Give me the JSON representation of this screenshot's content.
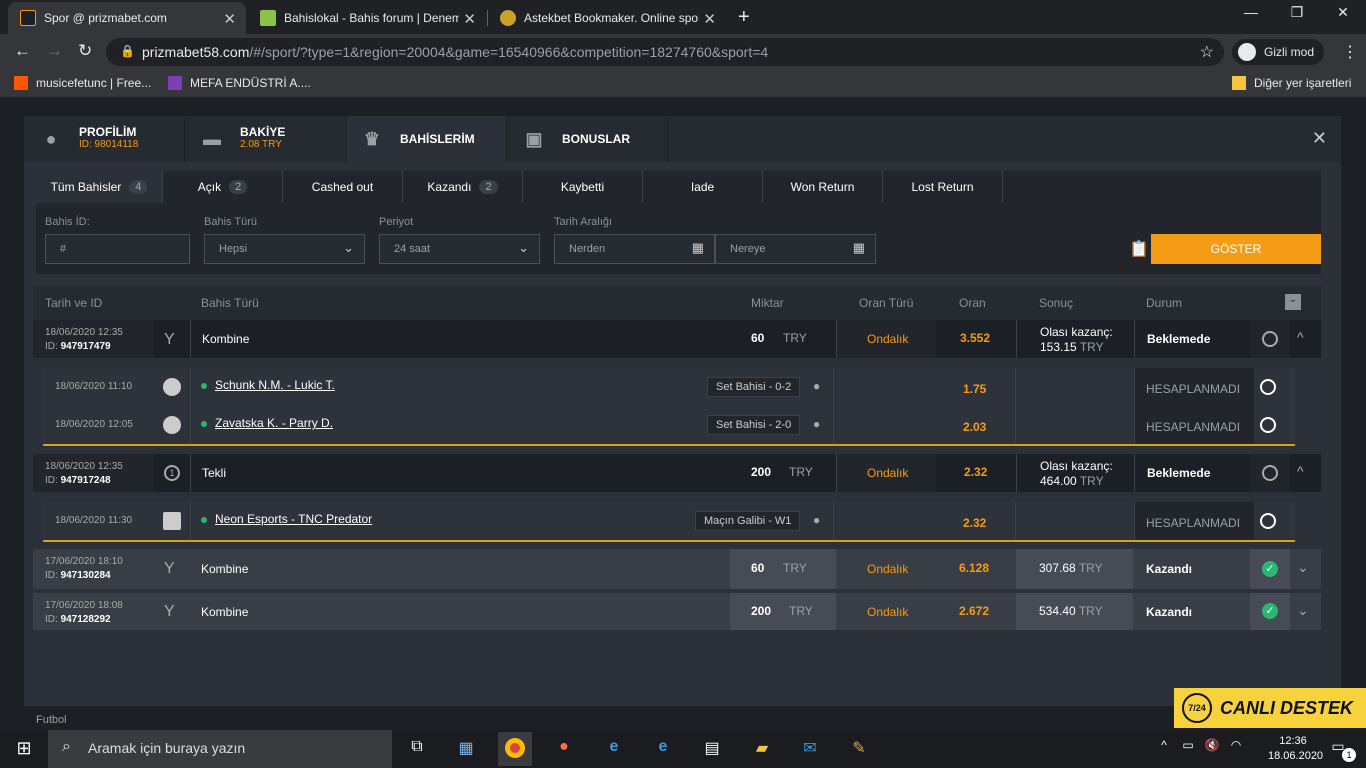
{
  "browser": {
    "tabs": [
      {
        "title": "Spor @ prizmabet.com",
        "color": "#f49c16"
      },
      {
        "title": "Bahislokal - Bahis forum | Denem",
        "color": "#8bc34a"
      },
      {
        "title": "Astekbet Bookmaker. Online spor",
        "color": "#c9a227"
      }
    ],
    "url_host": "prizmabet58.com",
    "url_path": "/#/sport/?type=1&region=20004&game=16540966&competition=18274760&sport=4",
    "incognito_label": "Gizli mod",
    "bookmarks": [
      {
        "label": "musicefetunc | Free..."
      },
      {
        "label": "MEFA ENDÜSTRİ A...."
      }
    ],
    "other_bookmarks": "Diğer yer işaretleri"
  },
  "modal": {
    "tabs": [
      {
        "title": "PROFİLİM",
        "sub": "ID: 98014118"
      },
      {
        "title": "BAKİYE",
        "sub": "2.08 TRY"
      },
      {
        "title": "BAHİSLERİM",
        "sub": ""
      },
      {
        "title": "BONUSLAR",
        "sub": ""
      }
    ],
    "filter_tabs": [
      {
        "label": "Tüm Bahisler",
        "count": "4"
      },
      {
        "label": "Açık",
        "count": "2"
      },
      {
        "label": "Cashed out",
        "count": ""
      },
      {
        "label": "Kazandı",
        "count": "2"
      },
      {
        "label": "Kaybetti",
        "count": ""
      },
      {
        "label": "Iade",
        "count": ""
      },
      {
        "label": "Won Return",
        "count": ""
      },
      {
        "label": "Lost Return",
        "count": ""
      }
    ],
    "filters": {
      "bet_id_label": "Bahis İD:",
      "bet_id_placeholder": "#",
      "bet_type_label": "Bahis Türü",
      "bet_type_value": "Hepsi",
      "period_label": "Periyot",
      "period_value": "24 saat",
      "date_range_label": "Tarih Aralığı",
      "from_placeholder": "Nerden",
      "to_placeholder": "Nereye",
      "show_button": "GÖSTER"
    },
    "table_headers": {
      "date_id": "Tarih ve ID",
      "bet_type": "Bahis Türü",
      "amount": "Miktar",
      "odds_type": "Oran Türü",
      "odds": "Oran",
      "result": "Sonuç",
      "status": "Durum"
    },
    "bets": [
      {
        "date": "18/06/2020 12:35",
        "id_label": "ID:",
        "id": "947917479",
        "type": "Kombine",
        "amount": "60",
        "currency": "TRY",
        "odds_type": "Ondalık",
        "odds": "3.552",
        "result_label": "Olası kazanç:",
        "result_value": "153.15",
        "result_currency": "TRY",
        "status": "Beklemede",
        "selections": [
          {
            "date": "18/06/2020 11:10",
            "match": "Schunk N.M. - Lukic T.",
            "market": "Set Bahisi - 0-2",
            "odds": "1.75",
            "status": "HESAPLANMADI"
          },
          {
            "date": "18/06/2020 12:05",
            "match": "Zavatska K. - Parry D.",
            "market": "Set Bahisi - 2-0",
            "odds": "2.03",
            "status": "HESAPLANMADI"
          }
        ]
      },
      {
        "date": "18/06/2020 12:35",
        "id_label": "ID:",
        "id": "947917248",
        "type": "Tekli",
        "amount": "200",
        "currency": "TRY",
        "odds_type": "Ondalık",
        "odds": "2.32",
        "result_label": "Olası kazanç:",
        "result_value": "464.00",
        "result_currency": "TRY",
        "status": "Beklemede",
        "selections": [
          {
            "date": "18/06/2020 11:30",
            "match": "Neon Esports - TNC Predator",
            "market": "Maçın Galibi - W1",
            "odds": "2.32",
            "status": "HESAPLANMADI"
          }
        ]
      },
      {
        "date": "17/06/2020 18:10",
        "id_label": "ID:",
        "id": "947130284",
        "type": "Kombine",
        "amount": "60",
        "currency": "TRY",
        "odds_type": "Ondalık",
        "odds": "6.128",
        "result_value": "307.68",
        "result_currency": "TRY",
        "status": "Kazandı"
      },
      {
        "date": "17/06/2020 18:08",
        "id_label": "ID:",
        "id": "947128292",
        "type": "Kombine",
        "amount": "200",
        "currency": "TRY",
        "odds_type": "Ondalık",
        "odds": "2.672",
        "result_value": "534.40",
        "result_currency": "TRY",
        "status": "Kazandı"
      }
    ]
  },
  "sidebar_ghost": {
    "football": "Futbol"
  },
  "support_widget": {
    "badge": "7/24",
    "text": "CANLI DESTEK"
  },
  "taskbar": {
    "search_placeholder": "Aramak için buraya yazın",
    "time": "12:36",
    "date": "18.06.2020",
    "notifications": "1"
  }
}
